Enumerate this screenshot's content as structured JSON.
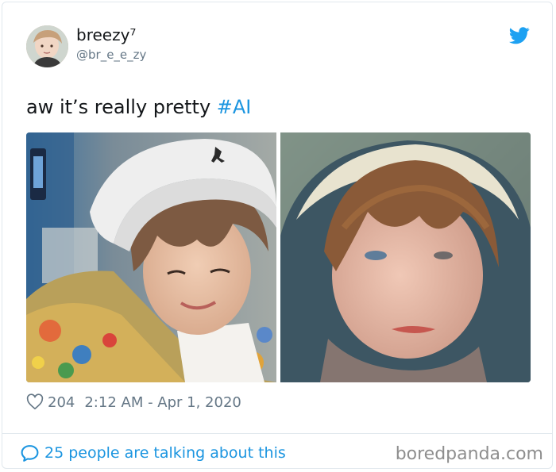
{
  "author": {
    "display_name": "breezy⁷",
    "handle": "@br_e_e_zy",
    "avatar_icon": "avatar"
  },
  "tweet": {
    "text_prefix": "aw it’s really pretty ",
    "hashtag": "#AI",
    "likes": "204",
    "timestamp": "2:12 AM - Apr 1, 2020"
  },
  "footer": {
    "talking": "25 people are talking about this"
  },
  "watermark": "boredpanda.com",
  "colors": {
    "twitter_blue": "#1da1f2",
    "link_blue": "#1b95e0",
    "muted": "#657786"
  },
  "icons": {
    "brand": "twitter-bird-icon",
    "like": "heart-icon",
    "reply": "speech-bubble-icon"
  }
}
